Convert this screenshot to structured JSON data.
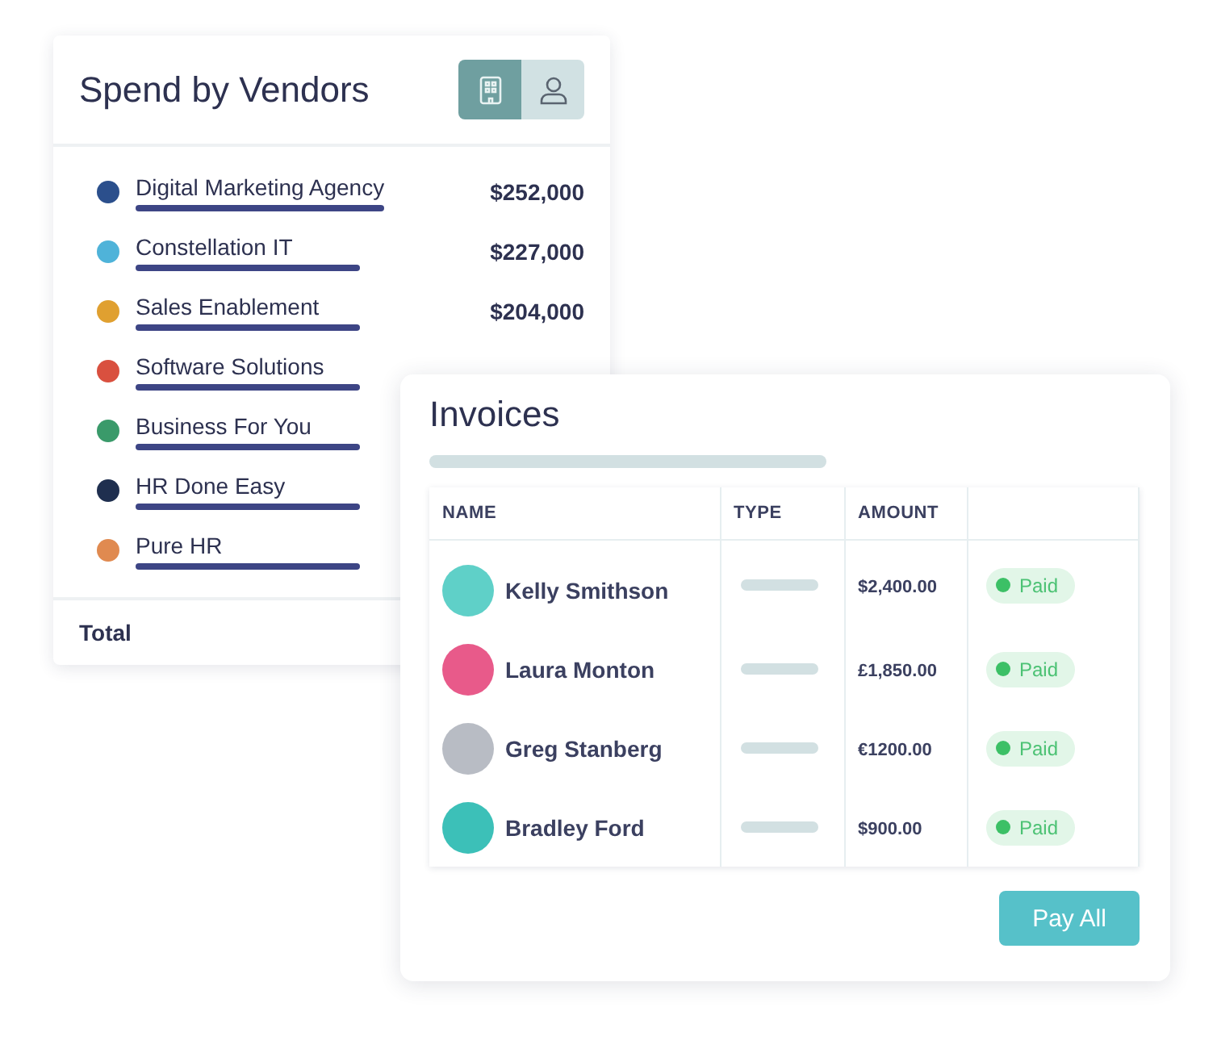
{
  "vendors_card": {
    "title": "Spend by Vendors",
    "view_toggle": [
      {
        "kind": "building",
        "selected": true
      },
      {
        "kind": "person",
        "selected": false
      }
    ],
    "vendors": [
      {
        "name": "Digital Marketing Agency",
        "amount": "$252,000",
        "color": "#2b4f8c"
      },
      {
        "name": "Constellation IT",
        "amount": "$227,000",
        "color": "#4fb3d9"
      },
      {
        "name": "Sales Enablement",
        "amount": "$204,000",
        "color": "#e0a030"
      },
      {
        "name": "Software Solutions",
        "color": "#d9503f"
      },
      {
        "name": "Business For You",
        "color": "#3a9a6a"
      },
      {
        "name": "HR Done Easy",
        "color": "#1f2f4f"
      },
      {
        "name": "Pure HR",
        "color": "#e08a50"
      }
    ],
    "total_label": "Total"
  },
  "invoices_card": {
    "title": "Invoices",
    "columns": [
      "NAME",
      "TYPE",
      "AMOUNT"
    ],
    "rows": [
      {
        "name": "Kelly Smithson",
        "amount": "$2,400.00",
        "status": "Paid",
        "color": "#5fd0c8"
      },
      {
        "name": "Laura Monton",
        "amount": "£1,850.00",
        "status": "Paid",
        "color": "#e85a8a"
      },
      {
        "name": "Greg Stanberg",
        "amount": "€1200.00",
        "status": "Paid",
        "color": "#b8bcc4"
      },
      {
        "name": "Bradley Ford",
        "amount": "$900.00",
        "status": "Paid",
        "color": "#3cc0b8"
      }
    ],
    "button": "Pay All"
  }
}
